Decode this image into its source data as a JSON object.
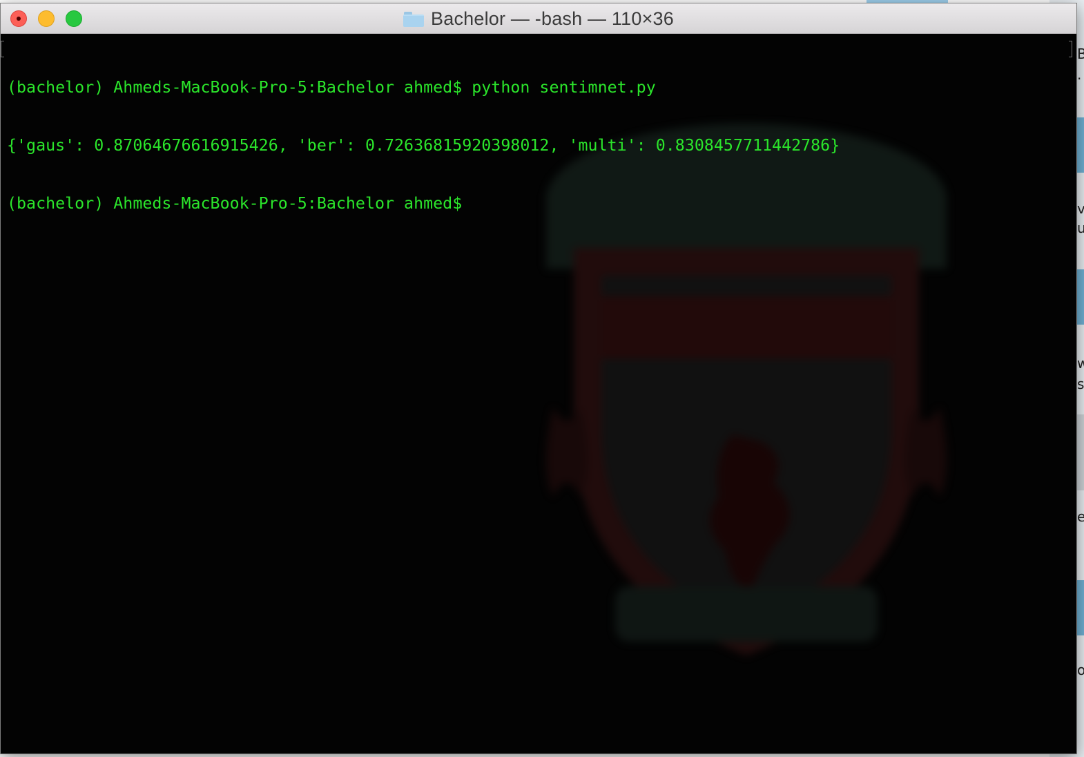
{
  "window": {
    "title": "Bachelor — -bash — 110×36",
    "folder_icon": "folder-icon"
  },
  "terminal": {
    "lines": [
      "(bachelor) Ahmeds-MacBook-Pro-5:Bachelor ahmed$ python sentimnet.py",
      "{'gaus': 0.8706467661691542​6, 'ber': 0.7263681592039801​2, 'multi': 0.8308457711442786}",
      "(bachelor) Ahmeds-MacBook-Pro-5:Bachelor ahmed$ "
    ],
    "text_color": "#2be52b",
    "background_color": "#030303"
  },
  "background_window": {
    "visible_chars": [
      "B",
      ".",
      "v",
      "u",
      "w",
      "s",
      "e",
      "o"
    ]
  },
  "colors": {
    "close": "#fc5f57",
    "minimize": "#fdbc2e",
    "maximize": "#28c840"
  }
}
